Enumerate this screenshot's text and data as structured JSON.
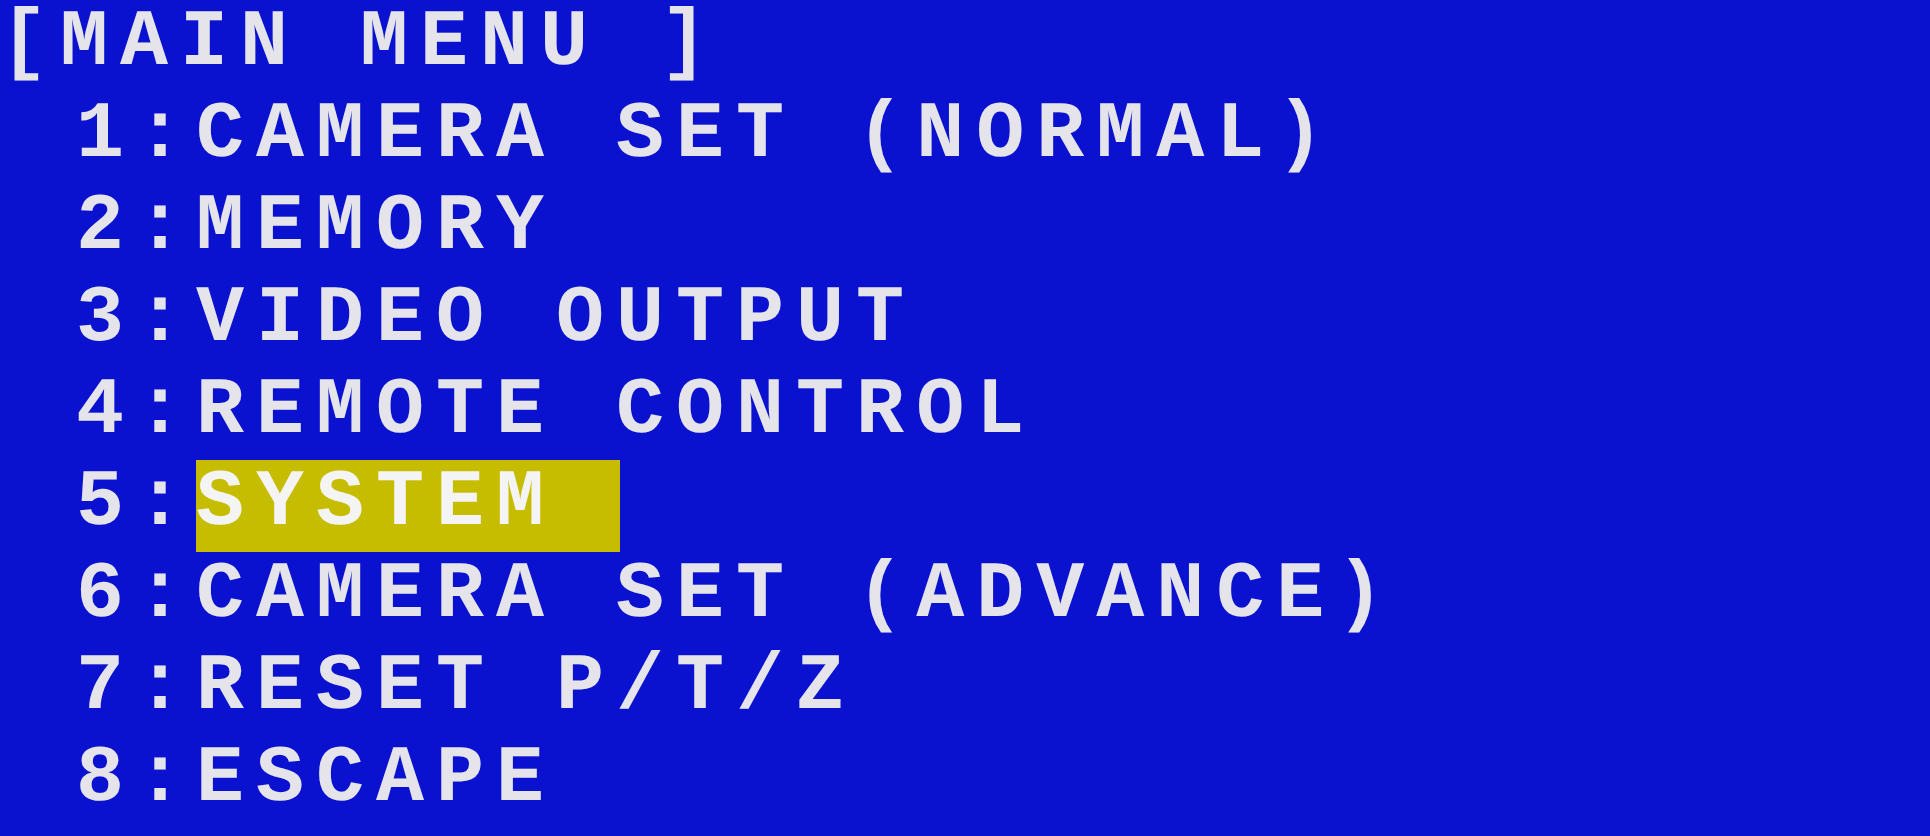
{
  "title": "[MAIN MENU ]",
  "items": [
    {
      "number": "1:",
      "label": "CAMERA SET (NORMAL)",
      "selected": false
    },
    {
      "number": "2:",
      "label": "MEMORY",
      "selected": false
    },
    {
      "number": "3:",
      "label": "VIDEO OUTPUT",
      "selected": false
    },
    {
      "number": "4:",
      "label": "REMOTE CONTROL",
      "selected": false
    },
    {
      "number": "5:",
      "label": "SYSTEM",
      "selected": true
    },
    {
      "number": "6:",
      "label": "CAMERA SET (ADVANCE)",
      "selected": false
    },
    {
      "number": "7:",
      "label": "RESET P/T/Z",
      "selected": false
    },
    {
      "number": "8:",
      "label": "ESCAPE",
      "selected": false
    }
  ]
}
